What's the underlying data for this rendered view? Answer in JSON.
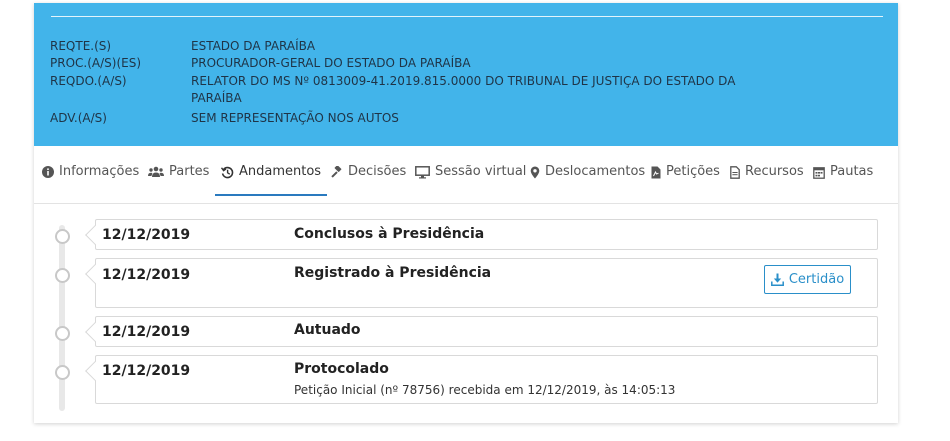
{
  "parties": [
    {
      "label": "REQTE.(S)",
      "value": "ESTADO DA PARAÍBA"
    },
    {
      "label": "PROC.(A/S)(ES)",
      "value": "PROCURADOR-GERAL DO ESTADO DA PARAÍBA"
    },
    {
      "label": "REQDO.(A/S)",
      "value": "RELATOR DO MS Nº 0813009-41.2019.815.0000 DO TRIBUNAL DE JUSTIÇA DO ESTADO DA PARAÍBA"
    },
    {
      "label": "ADV.(A/S)",
      "value": "SEM REPRESENTAÇÃO NOS AUTOS"
    }
  ],
  "tabs": [
    {
      "label": "Informações",
      "icon": "info-circle-icon"
    },
    {
      "label": "Partes",
      "icon": "users-icon"
    },
    {
      "label": "Andamentos",
      "icon": "history-icon",
      "active": true
    },
    {
      "label": "Decisões",
      "icon": "gavel-icon"
    },
    {
      "label": "Sessão virtual",
      "icon": "monitor-icon"
    },
    {
      "label": "Deslocamentos",
      "icon": "map-marker-icon"
    },
    {
      "label": "Petições",
      "icon": "pdf-file-icon"
    },
    {
      "label": "Recursos",
      "icon": "file-text-icon"
    },
    {
      "label": "Pautas",
      "icon": "calendar-icon"
    }
  ],
  "entries": [
    {
      "date": "12/12/2019",
      "title": "Conclusos à Presidência"
    },
    {
      "date": "12/12/2019",
      "title": "Registrado à Presidência",
      "button": "Certidão"
    },
    {
      "date": "12/12/2019",
      "title": "Autuado"
    },
    {
      "date": "12/12/2019",
      "title": "Protocolado",
      "description": "Petição Inicial (nº 78756) recebida em 12/12/2019, às 14:05:13"
    }
  ],
  "colors": {
    "header_bg": "#42b4ea",
    "accent": "#2a8fc9",
    "active_tab_underline": "#2a7abf"
  }
}
